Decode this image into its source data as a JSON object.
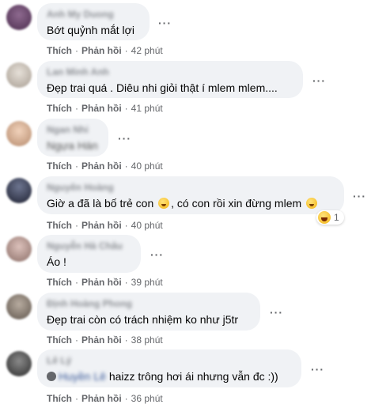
{
  "labels": {
    "like": "Thích",
    "reply": "Phản hồi",
    "separator": "·",
    "more": "···"
  },
  "comments": [
    {
      "name": "Anh My Duong",
      "text": "Bớt quỷnh mắt lợi",
      "time": "42 phút",
      "avatar_color": "#5b3a5e"
    },
    {
      "name": "Lan Minh Anh",
      "text": "Đẹp trai quá . Diêu nhi giỏi thật í mlem mlem....",
      "time": "41 phút",
      "avatar_color": "#c9c2b8"
    },
    {
      "name": "Ngan Nhi",
      "text": "Ngựa Hán",
      "time": "40 phút",
      "avatar_color": "#d9b49a"
    },
    {
      "name": "Nguyên Hoàng",
      "text_before": "Giờ a đã là bố trẻ con",
      "text_middle": ", có con rồi xin đừng mlem",
      "time": "40 phút",
      "reaction_count": "1",
      "avatar_color": "#2f3446"
    },
    {
      "name": "Nguyễn Hà Châu",
      "text": "Áo !",
      "time": "39 phút",
      "avatar_color": "#b79b94"
    },
    {
      "name": "Định Hoàng Phong",
      "text": "Đẹp trai còn có trách nhiệm ko như j5tr",
      "time": "38 phút",
      "avatar_color": "#8a7f74"
    },
    {
      "name": "Lê Lý",
      "mention": "Huyền Lê",
      "text": "haizz trông hơi ái nhưng vẫn đc :))",
      "time": "36 phút",
      "avatar_color": "#4a4a4a"
    }
  ]
}
